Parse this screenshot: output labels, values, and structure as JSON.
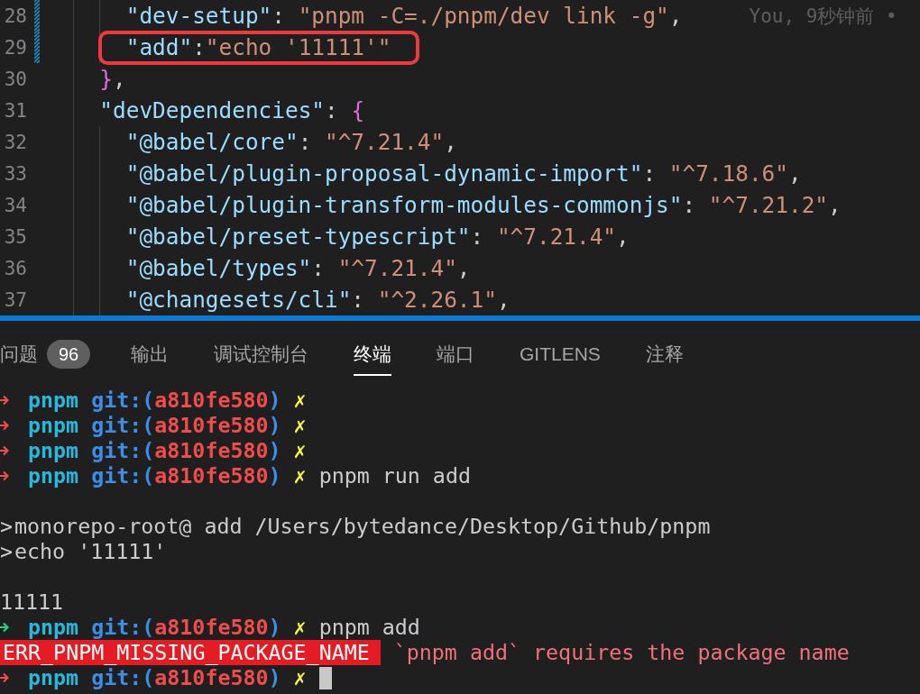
{
  "editor": {
    "lines": [
      {
        "children": [
          {
            "number": "28",
            "changed": true,
            "annotated": false,
            "tokens": [
              {
                "kind": "key",
                "text": "\"dev-setup\""
              },
              {
                "kind": "punct",
                "text": ": "
              },
              {
                "kind": "string",
                "text": "\"pnpm -C=./pnpm/dev link -g\""
              },
              {
                "kind": "punct",
                "text": ","
              }
            ],
            "blame": "You, 9秒钟前 •"
          },
          {
            "number": "29",
            "changed": true,
            "annotated": true,
            "tokens": [
              {
                "kind": "key",
                "text": "\"add\""
              },
              {
                "kind": "punct",
                "text": ":"
              },
              {
                "kind": "string",
                "text": "\"echo '11111'\""
              }
            ]
          }
        ]
      },
      {
        "number": "30",
        "changed": false,
        "annotated": false,
        "tokens": [
          {
            "kind": "brace",
            "text": "}"
          },
          {
            "kind": "punct",
            "text": ","
          }
        ]
      },
      {
        "number": "31",
        "changed": false,
        "annotated": false,
        "tokens": [
          {
            "kind": "key",
            "text": "\"devDependencies\""
          },
          {
            "kind": "punct",
            "text": ": "
          },
          {
            "kind": "brace",
            "text": "{"
          }
        ],
        "children": [
          {
            "number": "32",
            "changed": false,
            "annotated": false,
            "tokens": [
              {
                "kind": "key",
                "text": "\"@babel/core\""
              },
              {
                "kind": "punct",
                "text": ": "
              },
              {
                "kind": "string",
                "text": "\"^7.21.4\""
              },
              {
                "kind": "punct",
                "text": ","
              }
            ]
          },
          {
            "number": "33",
            "changed": false,
            "annotated": false,
            "tokens": [
              {
                "kind": "key",
                "text": "\"@babel/plugin-proposal-dynamic-import\""
              },
              {
                "kind": "punct",
                "text": ": "
              },
              {
                "kind": "string",
                "text": "\"^7.18.6\""
              },
              {
                "kind": "punct",
                "text": ","
              }
            ]
          },
          {
            "number": "34",
            "changed": false,
            "annotated": false,
            "tokens": [
              {
                "kind": "key",
                "text": "\"@babel/plugin-transform-modules-commonjs\""
              },
              {
                "kind": "punct",
                "text": ": "
              },
              {
                "kind": "string",
                "text": "\"^7.21.2\""
              },
              {
                "kind": "punct",
                "text": ","
              }
            ]
          },
          {
            "number": "35",
            "changed": false,
            "annotated": false,
            "tokens": [
              {
                "kind": "key",
                "text": "\"@babel/preset-typescript\""
              },
              {
                "kind": "punct",
                "text": ": "
              },
              {
                "kind": "string",
                "text": "\"^7.21.4\""
              },
              {
                "kind": "punct",
                "text": ","
              }
            ]
          },
          {
            "number": "36",
            "changed": false,
            "annotated": false,
            "tokens": [
              {
                "kind": "key",
                "text": "\"@babel/types\""
              },
              {
                "kind": "punct",
                "text": ": "
              },
              {
                "kind": "string",
                "text": "\"^7.21.4\""
              },
              {
                "kind": "punct",
                "text": ","
              }
            ]
          },
          {
            "number": "37",
            "changed": false,
            "annotated": false,
            "tokens": [
              {
                "kind": "key",
                "text": "\"@changesets/cli\""
              },
              {
                "kind": "punct",
                "text": ": "
              },
              {
                "kind": "string",
                "text": "\"^2.26.1\""
              },
              {
                "kind": "punct",
                "text": ","
              }
            ]
          }
        ]
      }
    ]
  },
  "panel": {
    "tabs": [
      {
        "label": "问题",
        "badge": "96",
        "selected": false
      },
      {
        "label": "输出",
        "selected": false
      },
      {
        "label": "调试控制台",
        "selected": false
      },
      {
        "label": "终端",
        "selected": true
      },
      {
        "label": "端口",
        "selected": false
      },
      {
        "label": "GITLENS",
        "selected": false
      },
      {
        "label": "注释",
        "selected": false
      }
    ]
  },
  "terminal": {
    "lines": [
      {
        "kind": "prompt",
        "failed": true,
        "dir": "pnpm",
        "git_label": "git:(",
        "branch": "a810fe580",
        "git_close": ")",
        "dirty": "✗",
        "cursor": false
      },
      {
        "kind": "prompt",
        "failed": true,
        "dir": "pnpm",
        "git_label": "git:(",
        "branch": "a810fe580",
        "git_close": ")",
        "dirty": "✗",
        "cursor": false
      },
      {
        "kind": "prompt",
        "failed": true,
        "dir": "pnpm",
        "git_label": "git:(",
        "branch": "a810fe580",
        "git_close": ")",
        "dirty": "✗",
        "cursor": false
      },
      {
        "kind": "prompt",
        "failed": true,
        "dir": "pnpm",
        "git_label": "git:(",
        "branch": "a810fe580",
        "git_close": ")",
        "dirty": "✗",
        "command": "pnpm run add",
        "cursor": false
      },
      {
        "kind": "blank"
      },
      {
        "kind": "output",
        "marker": ">",
        "text": "monorepo-root@ add /Users/bytedance/Desktop/Github/pnpm"
      },
      {
        "kind": "output",
        "marker": ">",
        "text": "echo '11111'"
      },
      {
        "kind": "blank"
      },
      {
        "kind": "output",
        "text": "11111"
      },
      {
        "kind": "prompt",
        "failed": false,
        "dir": "pnpm",
        "git_label": "git:(",
        "branch": "a810fe580",
        "git_close": ")",
        "dirty": "✗",
        "command": "pnpm add",
        "cursor": false
      },
      {
        "kind": "error",
        "code": "ERR_PNPM_MISSING_PACKAGE_NAME",
        "message": "`pnpm add` requires the package name"
      },
      {
        "kind": "prompt",
        "failed": true,
        "dir": "pnpm",
        "git_label": "git:(",
        "branch": "a810fe580",
        "git_close": ")",
        "dirty": "✗",
        "cursor": true
      }
    ]
  }
}
